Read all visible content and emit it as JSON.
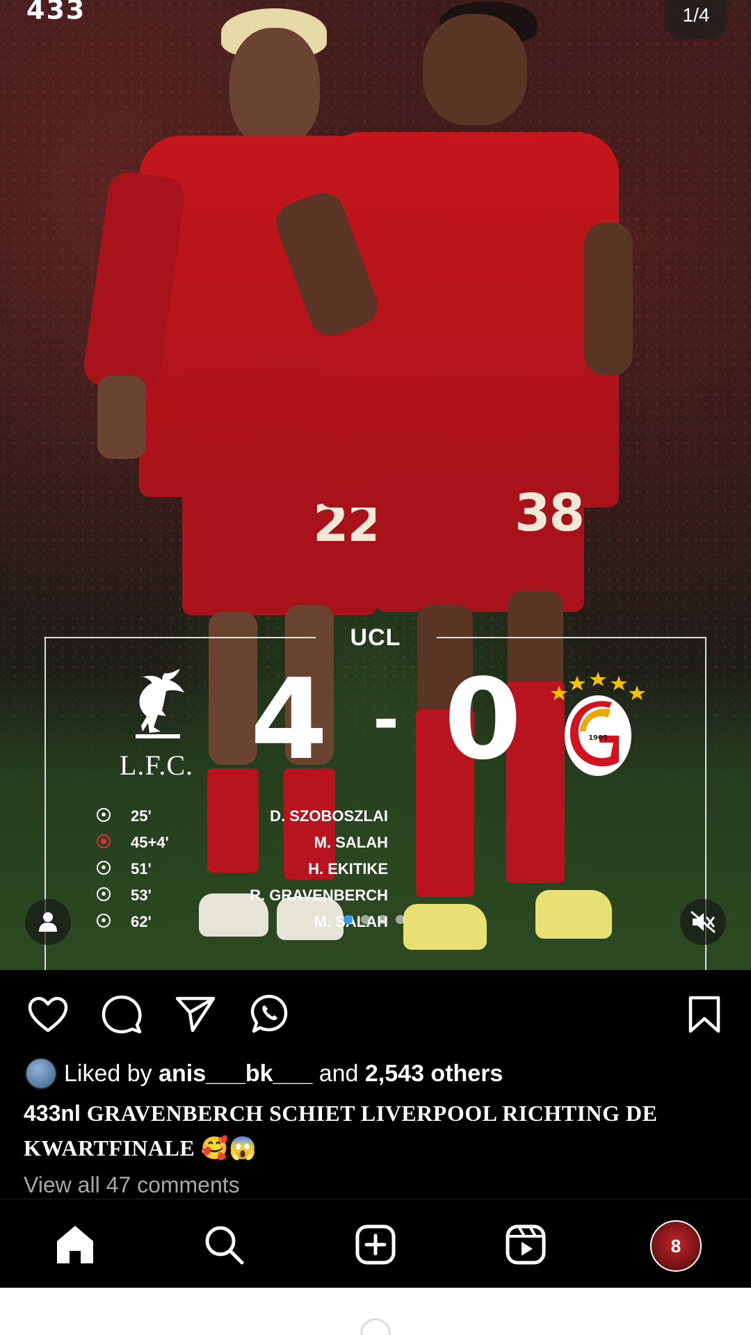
{
  "post": {
    "brand_logo": "433",
    "slide_counter": "1/4",
    "scoreboard": {
      "competition": "UCL",
      "home_team_crest_text": "L.F.C.",
      "home_score": "4",
      "separator": "-",
      "away_score": "0",
      "away_crest_year": "1905",
      "scorers": [
        {
          "icon": "ball-icon",
          "minute": "25'",
          "name": "D. SZOBOSZLAI"
        },
        {
          "icon": "penalty-ball-icon",
          "minute": "45+4'",
          "name": "M. SALAH"
        },
        {
          "icon": "ball-icon",
          "minute": "51'",
          "name": "H. EKITIKE"
        },
        {
          "icon": "ball-icon",
          "minute": "53'",
          "name": "R. GRAVENBERCH"
        },
        {
          "icon": "ball-icon",
          "minute": "62'",
          "name": "M. SALAH"
        }
      ]
    },
    "player_numbers": [
      "22",
      "38"
    ],
    "carousel": {
      "count": 4,
      "active": 0
    },
    "colors": {
      "kit_red": "#c4161c",
      "accent_blue": "#3897f0",
      "gold": "#f2c200"
    }
  },
  "actions": {
    "like_icon": "heart-icon",
    "comment_icon": "comment-icon",
    "share_icon": "send-icon",
    "whatsapp_icon": "whatsapp-icon",
    "save_icon": "bookmark-icon"
  },
  "likes": {
    "prefix": "Liked by ",
    "user": "anis___bk___",
    "middle": " and ",
    "count": "2,543 others"
  },
  "caption": {
    "username": "433nl",
    "text": "GRAVENBERCH SCHIET LIVERPOOL RICHTING DE KWARTFINALE 🥰😱"
  },
  "comments": {
    "label": "View all 47 comments"
  },
  "nav": {
    "items": [
      "home-icon",
      "search-icon",
      "create-icon",
      "reels-icon",
      "profile-avatar"
    ],
    "avatar_number": "8"
  }
}
